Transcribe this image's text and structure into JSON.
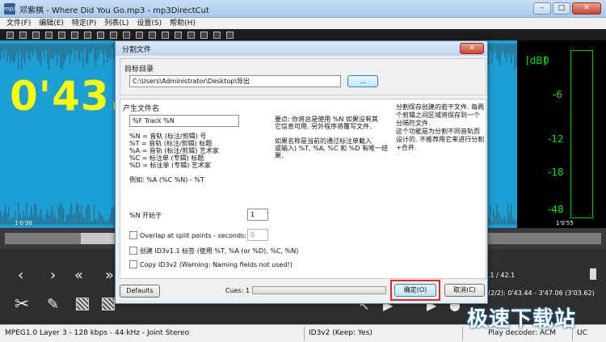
{
  "window": {
    "title": "邓紫棋 - Where Did You Go.mp3 - mp3DirectCut",
    "app_icon_text": "mp3",
    "controls": {
      "min": "–",
      "max": "□",
      "close": "✕"
    }
  },
  "menu": [
    "文件(F)",
    "编辑(E)",
    "特定(P)",
    "列表(L)",
    "设置(S)",
    "帮助(H)"
  ],
  "waveform": {
    "big_time": "0'43.",
    "time_left": "1'0'30",
    "time_right": "1'0'55",
    "wave_color": "#1b9fd4",
    "accent_yellow": "#ffff00"
  },
  "meter": {
    "unit": "[dB]",
    "levels": [
      "0",
      "-6",
      "-12",
      "-18",
      "-48"
    ],
    "color": "#00e000"
  },
  "transport": {
    "position_info": ".1 / 42.1",
    "selection_info": "(2/2): 0'43.44 - 3'47.06 (3'03.62)"
  },
  "status": {
    "format": "MPEG1.0 Layer 3 - 128 kbps - 44 kHz - Joint Stereo",
    "id3": "ID3v2 (Keep: Yes)",
    "decoder": "Play decoder: ACM",
    "extra": "UC"
  },
  "watermark": "极速下载站",
  "dialog": {
    "title": "分割文件",
    "close": "✕",
    "target_dir_label": "目标目录",
    "target_dir_value": "C:\\Users\\Administrator\\Desktop\\导出",
    "browse_label": "...",
    "gen_name_label": "产生文件名",
    "name_pattern": "%F Track %N",
    "legend_lines": [
      "%N = 音轨 (标注/剪辑) 号",
      "%T = 音轨 (标注/剪辑) 标题",
      "%A = 音轨 (标注/剪辑) 艺术家",
      "%C = 标注单 (专辑) 标题",
      "%D = 标注单 (专辑) 艺术家"
    ],
    "example": "例如: %A (%C %N) - %T",
    "note1": "要点: 你将总是使用 %N 如果没有其\n它信息可用. 另外程序将覆写文件.",
    "note2": "如果名称是当前的通过标注单載入\n或输入) %T, %A, %C 和 %D 有唯一结\n果.",
    "side_note": "分割保存创建的若干文件. 每两个剪辑之间区域将保存到一个分隔符文件.\n这个功能是为分割不同音轨而设计的. 不推荐用它来进行分割+合并.",
    "start_label": "%N 开始于",
    "start_value": "1",
    "overlap_label": "Overlap at split points - seconds:",
    "overlap_value": "0",
    "id3v1_label": "创建 ID3v1.1 标签 (使用 %T, %A (or %D), %C, %N)",
    "id3v2_label": "Copy ID3v2 (Warning: Naming fields not used!)",
    "defaults_label": "Defaults",
    "cues_label": "Cues: 1",
    "ok_label": "确定(O)",
    "cancel_label": "取消(C)"
  }
}
